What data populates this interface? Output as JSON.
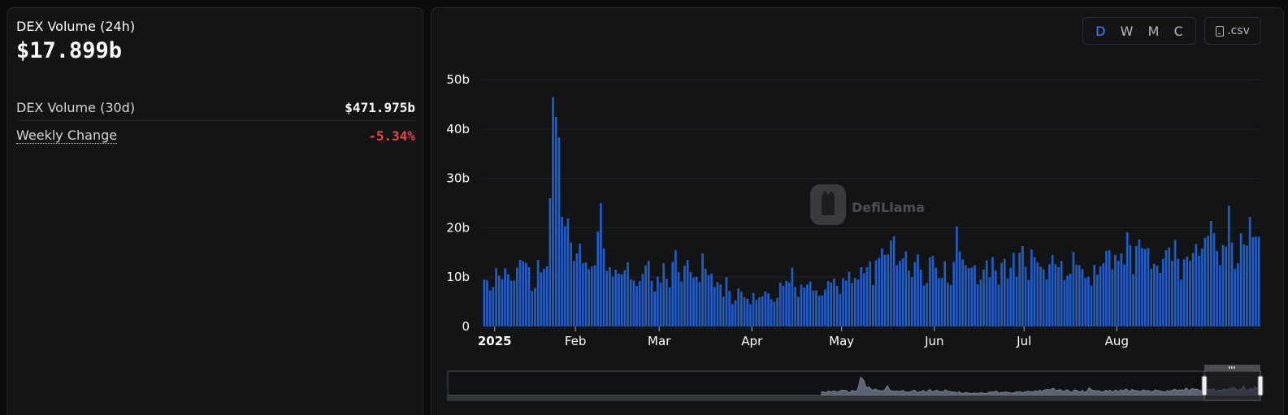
{
  "summary": {
    "volume_24h_label": "DEX Volume (24h)",
    "volume_24h_value": "$17.899b",
    "volume_30d_label": "DEX Volume (30d)",
    "volume_30d_value": "$471.975b",
    "weekly_change_label": "Weekly Change",
    "weekly_change_value": "-5.34%"
  },
  "toolbar": {
    "intervals": [
      "D",
      "W",
      "M",
      "C"
    ],
    "active_interval": "D",
    "csv_label": ".csv"
  },
  "watermark": {
    "text": "DefiLlama"
  },
  "colors": {
    "bar": "#1f5fcc",
    "negative": "#e94545",
    "active": "#3f84f5"
  },
  "chart_data": {
    "type": "bar",
    "y_tick_labels": [
      "0",
      "10b",
      "20b",
      "30b",
      "40b",
      "50b"
    ],
    "y_ticks": [
      0,
      10,
      20,
      30,
      40,
      50
    ],
    "ylim": [
      0,
      53
    ],
    "x_tick_labels": [
      {
        "label": "2025",
        "day": 4,
        "bold": true
      },
      {
        "label": "Feb",
        "day": 31,
        "bold": false
      },
      {
        "label": "Mar",
        "day": 59,
        "bold": false
      },
      {
        "label": "Apr",
        "day": 90,
        "bold": false
      },
      {
        "label": "May",
        "day": 120,
        "bold": false
      },
      {
        "label": "Jun",
        "day": 151,
        "bold": false
      },
      {
        "label": "Jul",
        "day": 181,
        "bold": false
      },
      {
        "label": "Aug",
        "day": 212,
        "bold": false
      }
    ],
    "x_start": "2024-12-28",
    "unit": "billion USD",
    "values": [
      9.5,
      9.4,
      7.3,
      8.0,
      11.8,
      10.3,
      9.6,
      11.8,
      10.6,
      9.3,
      9.3,
      11.9,
      13.5,
      13.2,
      12.9,
      12.0,
      7.3,
      7.8,
      13.5,
      11.0,
      11.7,
      12.2,
      26.0,
      46.5,
      42.5,
      38.3,
      22.2,
      20.3,
      21.9,
      17.0,
      13.3,
      14.8,
      16.8,
      12.8,
      13.0,
      11.6,
      12.2,
      12.4,
      19.2,
      25.0,
      15.8,
      11.3,
      12.0,
      10.1,
      11.5,
      10.7,
      10.6,
      11.4,
      13.0,
      9.6,
      9.3,
      8.2,
      9.2,
      10.6,
      12.4,
      13.3,
      9.2,
      7.1,
      10.1,
      8.9,
      12.8,
      9.7,
      7.9,
      13.1,
      15.5,
      11.0,
      9.1,
      12.3,
      13.5,
      11.0,
      9.9,
      10.1,
      9.0,
      14.8,
      11.7,
      10.4,
      10.7,
      8.0,
      9.0,
      8.5,
      6.0,
      10.0,
      7.2,
      4.6,
      5.3,
      7.7,
      7.0,
      5.9,
      5.6,
      4.5,
      6.8,
      5.4,
      5.9,
      6.1,
      7.1,
      6.7,
      5.5,
      5.0,
      5.8,
      8.9,
      8.2,
      9.2,
      8.9,
      11.9,
      8.0,
      6.0,
      8.5,
      7.9,
      8.5,
      9.1,
      7.3,
      7.3,
      6.2,
      6.3,
      7.5,
      9.2,
      8.9,
      9.7,
      8.2,
      6.6,
      9.8,
      9.3,
      11.1,
      8.8,
      9.8,
      9.5,
      12.0,
      10.8,
      12.0,
      13.2,
      8.4,
      13.4,
      13.9,
      15.8,
      14.5,
      14.6,
      17.4,
      18.3,
      12.4,
      13.3,
      13.8,
      15.2,
      11.3,
      10.0,
      13.1,
      14.6,
      11.5,
      8.3,
      8.8,
      14.0,
      14.3,
      11.9,
      9.8,
      9.8,
      13.2,
      8.9,
      8.4,
      13.1,
      20.3,
      15.2,
      13.6,
      12.4,
      11.8,
      11.9,
      12.4,
      8.5,
      9.5,
      11.5,
      13.4,
      10.0,
      14.1,
      11.3,
      8.5,
      12.9,
      13.7,
      9.7,
      11.9,
      14.9,
      10.1,
      15.0,
      16.3,
      12.1,
      9.4,
      15.6,
      14.0,
      13.0,
      12.1,
      11.6,
      9.5,
      12.6,
      14.5,
      12.6,
      12.0,
      13.3,
      9.4,
      10.3,
      10.7,
      15.1,
      12.5,
      12.4,
      11.6,
      9.8,
      10.1,
      8.3,
      12.5,
      10.5,
      12.2,
      12.8,
      15.3,
      15.5,
      11.6,
      14.5,
      13.3,
      14.8,
      12.6,
      19.1,
      16.5,
      10.6,
      16.3,
      17.6,
      15.9,
      15.7,
      15.9,
      11.7,
      12.7,
      12.3,
      10.9,
      13.7,
      15.5,
      16.0,
      13.3,
      17.5,
      13.7,
      9.5,
      13.6,
      14.2,
      13.3,
      14.9,
      16.7,
      14.3,
      15.8,
      18.0,
      18.4,
      21.4,
      18.9,
      15.3,
      12.4,
      16.5,
      16.2,
      24.5,
      17.0,
      11.7,
      12.8,
      18.9,
      16.6,
      16.4,
      22.2,
      18.1,
      18.2,
      18.2
    ]
  }
}
